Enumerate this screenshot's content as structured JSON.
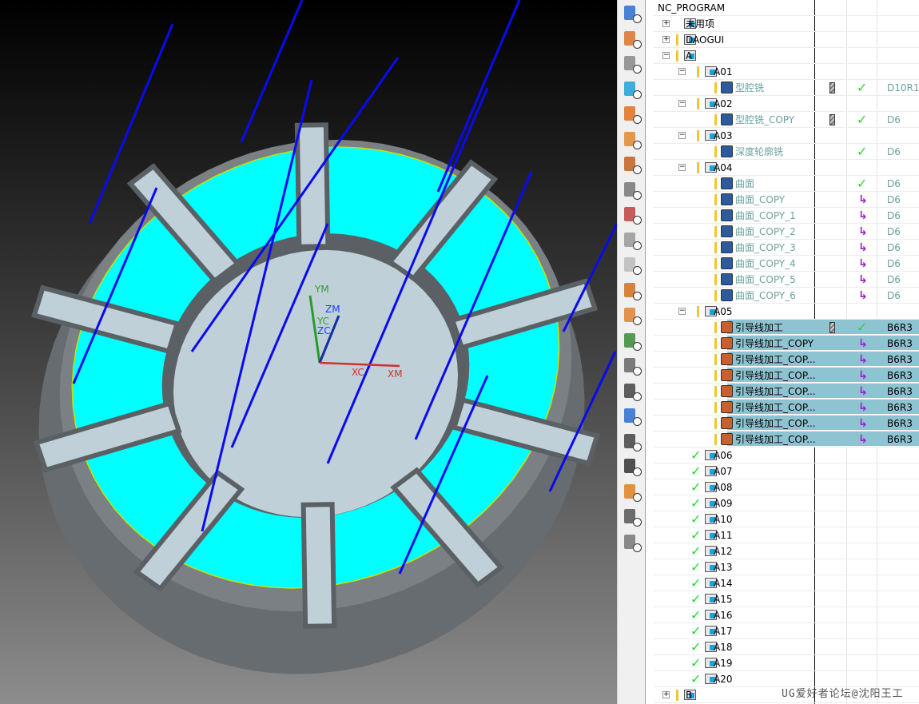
{
  "viewport": {
    "axis_labels": {
      "ym": "YM",
      "yc": "YC",
      "zm": "ZM",
      "zc": "ZC",
      "xc": "XC",
      "xm": "XM"
    },
    "colors": {
      "floor": "#00ffff",
      "part": "#c0d0d8",
      "wall": "#5a6064",
      "toolpath": "#0000ff"
    }
  },
  "toolbar": {
    "icons": [
      "program-order-view-icon",
      "machine-tool-view-icon",
      "geometry-view-icon",
      "create-program-icon",
      "create-tool-icon",
      "create-geometry-icon",
      "create-method-icon",
      "generate-toolpath-icon",
      "verify-toolpath-icon",
      "machine-tool-icon",
      "postprocess-icon",
      "replay-toolpath-icon",
      "shop-doc-icon",
      "feed-speed-icon",
      "tool-path-icon",
      "output-cls-icon",
      "shop-documentation-icon",
      "output-icon",
      "save-icon",
      "show-icon",
      "hide-icon",
      "ipw-icon"
    ]
  },
  "tree": {
    "root": "NC_PROGRAM",
    "rows": [
      {
        "level": 0,
        "type": "group",
        "label": "未用项",
        "expander": "+",
        "flag": false
      },
      {
        "level": 0,
        "type": "group",
        "label": "DAOGUI",
        "expander": "+",
        "flag": true
      },
      {
        "level": 0,
        "type": "group",
        "label": "A",
        "expander": "-",
        "flag": true
      },
      {
        "level": 1,
        "type": "group",
        "label": "A01",
        "expander": "-",
        "flag": true
      },
      {
        "level": 2,
        "type": "op",
        "label": "型腔铣",
        "tool": true,
        "status": "check",
        "toolname": "D10R1",
        "dim": true
      },
      {
        "level": 1,
        "type": "group",
        "label": "A02",
        "expander": "-",
        "flag": true
      },
      {
        "level": 2,
        "type": "op",
        "label": "型腔铣_COPY",
        "tool": true,
        "status": "check",
        "toolname": "D6",
        "dim": true
      },
      {
        "level": 1,
        "type": "group",
        "label": "A03",
        "expander": "-",
        "flag": true
      },
      {
        "level": 2,
        "type": "op",
        "label": "深度轮廓铣",
        "status": "check",
        "toolname": "D6",
        "dim": true
      },
      {
        "level": 1,
        "type": "group",
        "label": "A04",
        "expander": "-",
        "flag": true
      },
      {
        "level": 2,
        "type": "op",
        "label": "曲面",
        "status": "check",
        "toolname": "D6",
        "dim": true
      },
      {
        "level": 2,
        "type": "op",
        "label": "曲面_COPY",
        "status": "regen",
        "toolname": "D6",
        "dim": true
      },
      {
        "level": 2,
        "type": "op",
        "label": "曲面_COPY_1",
        "status": "regen",
        "toolname": "D6",
        "dim": true
      },
      {
        "level": 2,
        "type": "op",
        "label": "曲面_COPY_2",
        "status": "regen",
        "toolname": "D6",
        "dim": true
      },
      {
        "level": 2,
        "type": "op",
        "label": "曲面_COPY_3",
        "status": "regen",
        "toolname": "D6",
        "dim": true
      },
      {
        "level": 2,
        "type": "op",
        "label": "曲面_COPY_4",
        "status": "regen",
        "toolname": "D6",
        "dim": true
      },
      {
        "level": 2,
        "type": "op",
        "label": "曲面_COPY_5",
        "status": "regen",
        "toolname": "D6",
        "dim": true
      },
      {
        "level": 2,
        "type": "op",
        "label": "曲面_COPY_6",
        "status": "regen",
        "toolname": "D6",
        "dim": true
      },
      {
        "level": 1,
        "type": "group",
        "label": "A05",
        "expander": "-",
        "flag": true
      },
      {
        "level": 2,
        "type": "op",
        "label": "引导线加工",
        "tool": true,
        "status": "check",
        "toolname": "B6R3",
        "selected": true
      },
      {
        "level": 2,
        "type": "op",
        "label": "引导线加工_COPY",
        "status": "regen",
        "toolname": "B6R3",
        "selected": true
      },
      {
        "level": 2,
        "type": "op",
        "label": "引导线加工_COP...",
        "status": "regen",
        "toolname": "B6R3",
        "selected": true
      },
      {
        "level": 2,
        "type": "op",
        "label": "引导线加工_COP...",
        "status": "regen",
        "toolname": "B6R3",
        "selected": true
      },
      {
        "level": 2,
        "type": "op",
        "label": "引导线加工_COP...",
        "status": "regen",
        "toolname": "B6R3",
        "selected": true
      },
      {
        "level": 2,
        "type": "op",
        "label": "引导线加工_COP...",
        "status": "regen",
        "toolname": "B6R3",
        "selected": true
      },
      {
        "level": 2,
        "type": "op",
        "label": "引导线加工_COP...",
        "status": "regen",
        "toolname": "B6R3",
        "selected": true
      },
      {
        "level": 2,
        "type": "op",
        "label": "引导线加工_COP...",
        "status": "regen",
        "toolname": "B6R3",
        "selected": true
      },
      {
        "level": 1,
        "type": "group",
        "label": "A06",
        "done": true
      },
      {
        "level": 1,
        "type": "group",
        "label": "A07",
        "done": true
      },
      {
        "level": 1,
        "type": "group",
        "label": "A08",
        "done": true
      },
      {
        "level": 1,
        "type": "group",
        "label": "A09",
        "done": true
      },
      {
        "level": 1,
        "type": "group",
        "label": "A10",
        "done": true
      },
      {
        "level": 1,
        "type": "group",
        "label": "A11",
        "done": true
      },
      {
        "level": 1,
        "type": "group",
        "label": "A12",
        "done": true
      },
      {
        "level": 1,
        "type": "group",
        "label": "A13",
        "done": true
      },
      {
        "level": 1,
        "type": "group",
        "label": "A14",
        "done": true
      },
      {
        "level": 1,
        "type": "group",
        "label": "A15",
        "done": true
      },
      {
        "level": 1,
        "type": "group",
        "label": "A16",
        "done": true
      },
      {
        "level": 1,
        "type": "group",
        "label": "A17",
        "done": true
      },
      {
        "level": 1,
        "type": "group",
        "label": "A18",
        "done": true
      },
      {
        "level": 1,
        "type": "group",
        "label": "A19",
        "done": true
      },
      {
        "level": 1,
        "type": "group",
        "label": "A20",
        "done": true
      },
      {
        "level": 0,
        "type": "group",
        "label": "B",
        "expander": "+",
        "flag": true
      }
    ],
    "colors": {
      "selected": "#8ec3d1",
      "check": "#2bd42b",
      "regen": "#9b20c8",
      "dim_text": "#6aa3a0",
      "flag": "#f7c23c"
    }
  },
  "watermark": "UG爱好者论坛@沈阳王工"
}
